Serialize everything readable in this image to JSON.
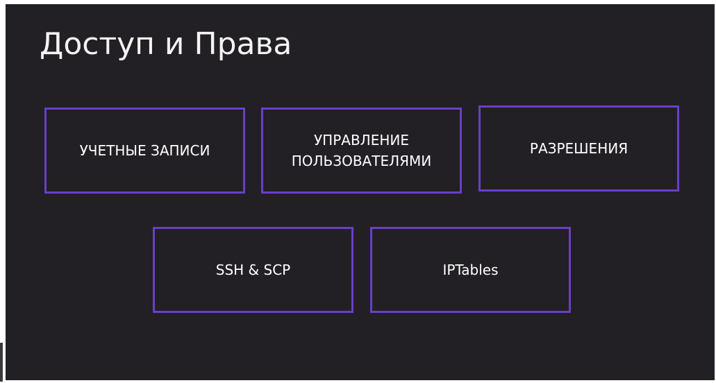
{
  "slide": {
    "title": "Доступ и Права",
    "accent_color": "#6a3fc7",
    "background_color": "#222025",
    "tiles": [
      {
        "label": "УЧЕТНЫЕ ЗАПИСИ"
      },
      {
        "label": "УПРАВЛЕНИЕ\nПОЛЬЗОВАТЕЛЯМИ"
      },
      {
        "label": "РАЗРЕШЕНИЯ"
      },
      {
        "label": "SSH & SCP"
      },
      {
        "label": "IPTables"
      }
    ]
  }
}
